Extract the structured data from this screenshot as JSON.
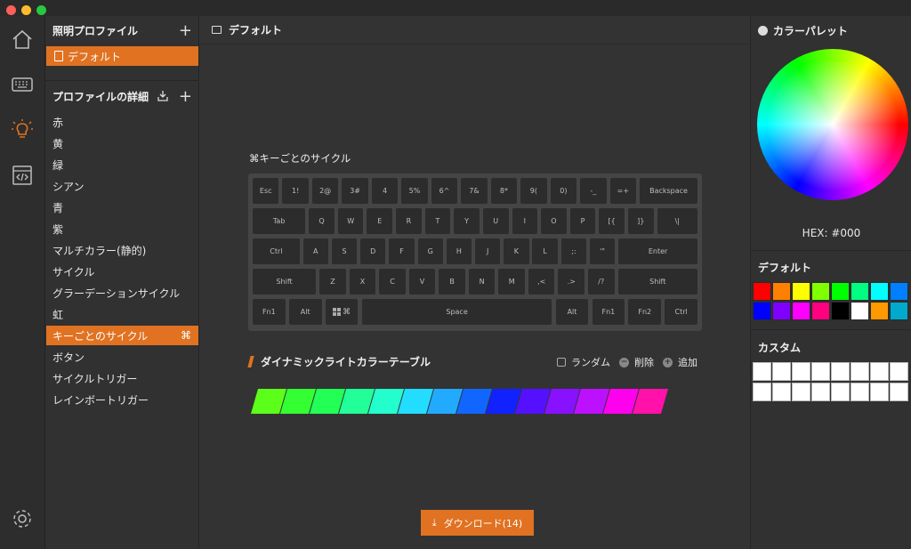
{
  "nav": {
    "items": [
      "home-icon",
      "keyboard-icon",
      "lightbulb-icon",
      "code-icon"
    ],
    "settings": "gear-icon",
    "active_color": "#e07222"
  },
  "profiles": {
    "header": "照明プロファイル",
    "add": "+",
    "items": [
      "デフォルト"
    ],
    "details_header": "プロファイルの詳細",
    "modes": [
      "赤",
      "黄",
      "緑",
      "シアン",
      "青",
      "紫",
      "マルチカラー(静的)",
      "サイクル",
      "グラーデーションサイクル",
      "虹",
      "キーごとのサイクル",
      "ボタン",
      "サイクルトリガー",
      "レインボートリガー"
    ],
    "active_mode": "キーごとのサイクル",
    "active_mode_icon": "⌘"
  },
  "main": {
    "profile_name": "デフォルト",
    "keyboard_title": "⌘キーごとのサイクル",
    "keys": [
      [
        "Esc",
        "1!",
        "2@",
        "3#",
        "4",
        "5%",
        "6^",
        "7&",
        "8*",
        "9(",
        "0)",
        "-_",
        "=+",
        "Backspace"
      ],
      [
        "Tab",
        "Q",
        "W",
        "E",
        "R",
        "T",
        "Y",
        "U",
        "I",
        "O",
        "P",
        "[{",
        "]}",
        "\\|"
      ],
      [
        "Ctrl",
        "A",
        "S",
        "D",
        "F",
        "G",
        "H",
        "J",
        "K",
        "L",
        ";:",
        "'\"",
        "Enter"
      ],
      [
        "Shift",
        "Z",
        "X",
        "C",
        "V",
        "B",
        "N",
        "M",
        ",<",
        ".>",
        "/?",
        "Shift"
      ],
      [
        "Fn1",
        "Alt",
        "",
        "Space",
        "Alt",
        "Fn1",
        "Fn2",
        "Ctrl"
      ]
    ],
    "dynamic_title": "ダイナミックライトカラーテーブル",
    "actions": [
      "ランダム",
      "削除",
      "追加"
    ],
    "swatches": [
      "#5cff1a",
      "#33ff33",
      "#22ff55",
      "#22ff99",
      "#22ffcc",
      "#22ddff",
      "#22aaff",
      "#1166ff",
      "#1122ff",
      "#5511ff",
      "#8811ff",
      "#bb11ff",
      "#ff00ee",
      "#ff11aa"
    ],
    "download_label": "ダウンロード(14)"
  },
  "palette": {
    "header": "カラーパレット",
    "hex_label": "HEX: #000",
    "default_header": "デフォルト",
    "default_colors": [
      "#ff0000",
      "#ff8000",
      "#ffff00",
      "#80ff00",
      "#00ff00",
      "#00ff80",
      "#00ffff",
      "#0080ff",
      "#0000ff",
      "#8000ff",
      "#ff00ff",
      "#ff0080",
      "#000000",
      "#ffffff",
      "#ff9900",
      "#00aacc"
    ],
    "custom_header": "カスタム"
  }
}
